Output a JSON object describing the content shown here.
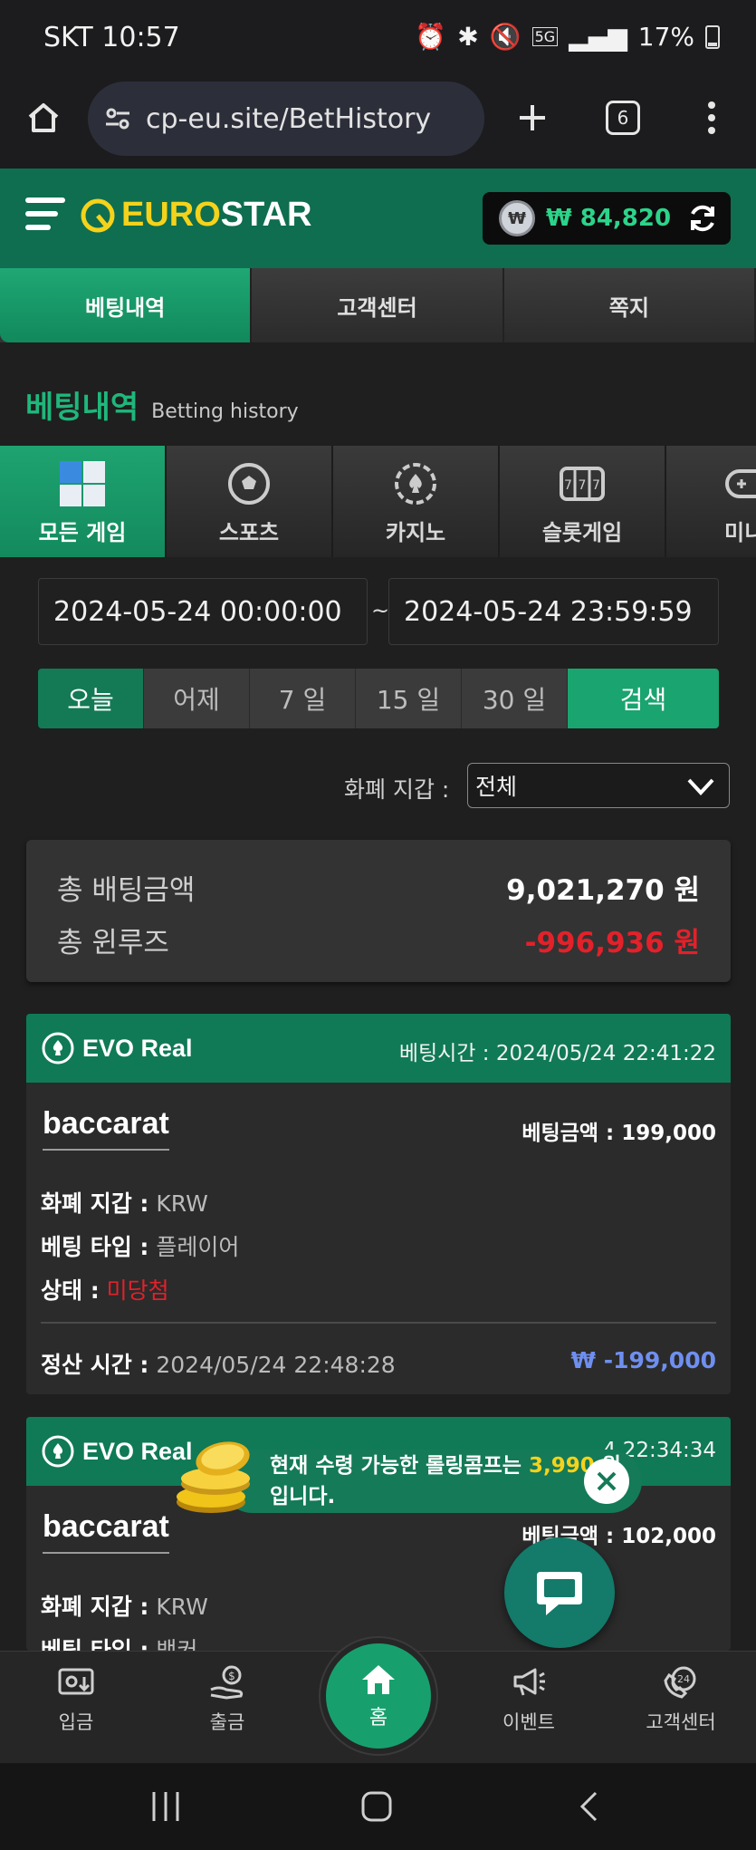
{
  "status_bar": {
    "carrier": "SKT",
    "time": "10:57",
    "network": "5G",
    "battery": "17%"
  },
  "browser": {
    "url": "cp-eu.site/BetHistory",
    "tab_count": "6"
  },
  "site": {
    "logo_euro": "EURO",
    "logo_star": "STAR",
    "wallet_symbol": "₩",
    "wallet_amount": "₩ 84,820"
  },
  "nav_tabs": [
    {
      "label": "베팅내역",
      "active": true
    },
    {
      "label": "고객센터",
      "active": false
    },
    {
      "label": "쪽지",
      "active": false
    }
  ],
  "page_title": {
    "ko": "베팅내역",
    "en": "Betting history"
  },
  "game_tabs": [
    {
      "label": "모든 게임",
      "icon": "all-games-icon",
      "active": true
    },
    {
      "label": "스포츠",
      "icon": "soccer-ball-icon",
      "active": false
    },
    {
      "label": "카지노",
      "icon": "casino-chip-icon",
      "active": false
    },
    {
      "label": "슬롯게임",
      "icon": "slot-machine-icon",
      "active": false
    },
    {
      "label": "미니",
      "icon": "gamepad-icon",
      "active": false
    }
  ],
  "date_range": {
    "start": "2024-05-24 00:00:00",
    "separator": "~",
    "end": "2024-05-24 23:59:59"
  },
  "periods": [
    {
      "label": "오늘",
      "active": true
    },
    {
      "label": "어제",
      "active": false
    },
    {
      "label": "7 일",
      "active": false
    },
    {
      "label": "15 일",
      "active": false
    },
    {
      "label": "30 일",
      "active": false
    }
  ],
  "search_label": "검색",
  "wallet_filter": {
    "label": "화폐 지갑 :",
    "value": "전체"
  },
  "summary": {
    "total_bet_label": "총 배팅금액",
    "total_bet_value": "9,021,270 원",
    "total_winloss_label": "총 윈루즈",
    "total_winloss_value": "-996,936 원"
  },
  "bets": [
    {
      "provider": "EVO Real",
      "bet_time": "베팅시간 : 2024/05/24 22:41:22",
      "game": "baccarat",
      "bet_amount": "베팅금액 : 199,000",
      "currency_label": "화폐 지갑 :",
      "currency": "KRW",
      "type_label": "베팅 타입 :",
      "type": "플레이어",
      "status_label": "상태 :",
      "status": "미당첨",
      "settle_label": "정산 시간 :",
      "settle_time": "2024/05/24 22:48:28",
      "payout": "₩ -199,000"
    },
    {
      "provider": "EVO Real",
      "bet_time": "4 22:34:34",
      "game": "baccarat",
      "bet_amount": "베팅금액 : 102,000",
      "currency_label": "화폐 지갑 :",
      "currency": "KRW",
      "type_label": "베팅 타입 :",
      "type": "뱅커"
    }
  ],
  "toast": {
    "text_before": "현재 수령 가능한 롤링콤프는 ",
    "highlight": "3,990",
    "text_after": " 원",
    "line2": "입니다."
  },
  "bottom_nav": [
    {
      "label": "입금",
      "icon": "deposit-icon"
    },
    {
      "label": "출금",
      "icon": "withdraw-icon"
    },
    {
      "label": "홈",
      "icon": "home-icon"
    },
    {
      "label": "이벤트",
      "icon": "megaphone-icon"
    },
    {
      "label": "고객센터",
      "icon": "support-24-icon"
    }
  ],
  "colors": {
    "brand_green": "#0e6e4f",
    "accent_green": "#1aa46f",
    "loss_red": "#e3212a",
    "payout_blue": "#6f8ff0",
    "logo_yellow": "#f5d21b"
  }
}
